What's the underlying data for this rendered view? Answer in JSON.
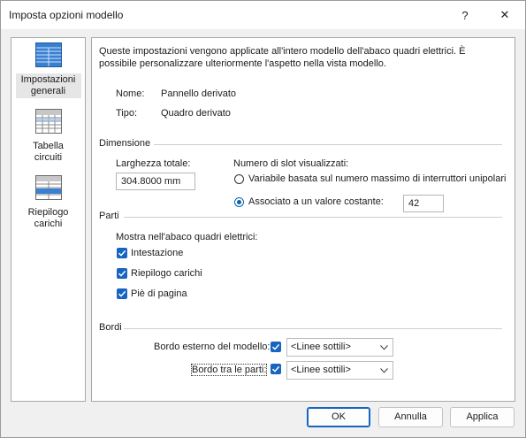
{
  "window": {
    "title": "Imposta opzioni modello",
    "help_glyph": "?",
    "close_glyph": "✕"
  },
  "sidebar": {
    "items": [
      {
        "label": "Impostazioni generali",
        "icon": "general-settings-icon",
        "selected": true
      },
      {
        "label": "Tabella circuiti",
        "icon": "circuit-table-icon",
        "selected": false
      },
      {
        "label": "Riepilogo carichi",
        "icon": "load-summary-icon",
        "selected": false
      }
    ]
  },
  "content": {
    "intro": "Queste impostazioni vengono applicate all'intero modello dell'abaco quadri elettrici. È possibile personalizzare ulteriormente l'aspetto nella vista modello.",
    "name_label": "Nome:",
    "name_value": "Pannello derivato",
    "type_label": "Tipo:",
    "type_value": "Quadro derivato",
    "dimension": {
      "section": "Dimensione",
      "width_label": "Larghezza totale:",
      "width_value": "304.8000 mm",
      "slots_label": "Numero di slot visualizzati:",
      "variable_label": "Variabile basata sul numero massimo di interruttori unipolari",
      "constant_label": "Associato a un valore costante:",
      "constant_value": "42"
    },
    "parts": {
      "section": "Parti",
      "show_label": "Mostra nell'abaco quadri elettrici:",
      "header_label": "Intestazione",
      "summary_label": "Riepilogo carichi",
      "footer_label": "Piè di pagina"
    },
    "borders": {
      "section": "Bordi",
      "outer_label": "Bordo esterno del modello:",
      "outer_value": "<Linee sottili>",
      "between_label": "Bordo tra le parti:",
      "between_value": "<Linee sottili>"
    }
  },
  "buttons": {
    "ok": "OK",
    "cancel": "Annulla",
    "apply": "Applica"
  },
  "colors": {
    "accent": "#1765c1",
    "icon_blue": "#2d6fc0"
  }
}
